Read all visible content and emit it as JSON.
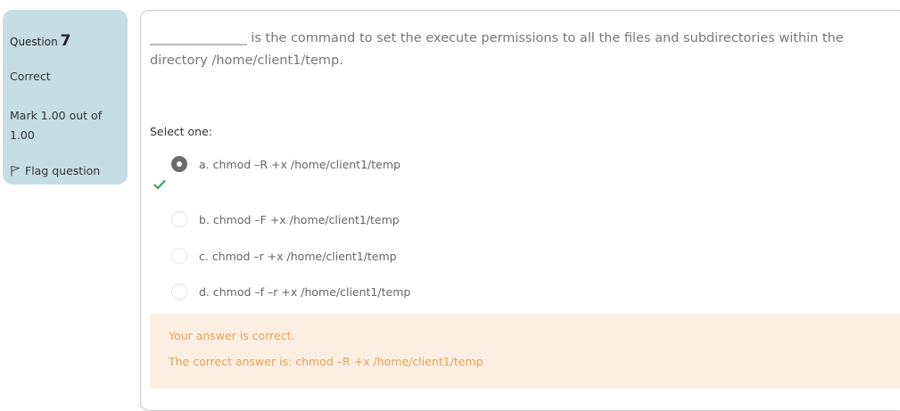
{
  "info": {
    "question_label": "Question",
    "question_number": "7",
    "state": "Correct",
    "grade": "Mark 1.00 out of 1.00",
    "flag_label": "Flag question"
  },
  "question": {
    "text": "_______________ is the command to set the execute permissions to all the files and subdirectories within the directory /home/client1/temp.",
    "prompt": "Select one:",
    "options": [
      {
        "label": "a. chmod –R +x /home/client1/temp",
        "selected": true
      },
      {
        "label": "b. chmod –F +x /home/client1/temp",
        "selected": false
      },
      {
        "label": "c. chmod –r +x /home/client1/temp",
        "selected": false
      },
      {
        "label": "d. chmod –f –r +x /home/client1/temp",
        "selected": false
      }
    ]
  },
  "feedback": {
    "result": "Your answer is correct.",
    "correct_answer": "The correct answer is: chmod –R +x /home/client1/temp"
  },
  "colors": {
    "info_bg": "#c6dde6",
    "feedback_bg": "#fcefe1",
    "feedback_text": "#e6a15a",
    "correct_tick": "#3aa55f"
  }
}
